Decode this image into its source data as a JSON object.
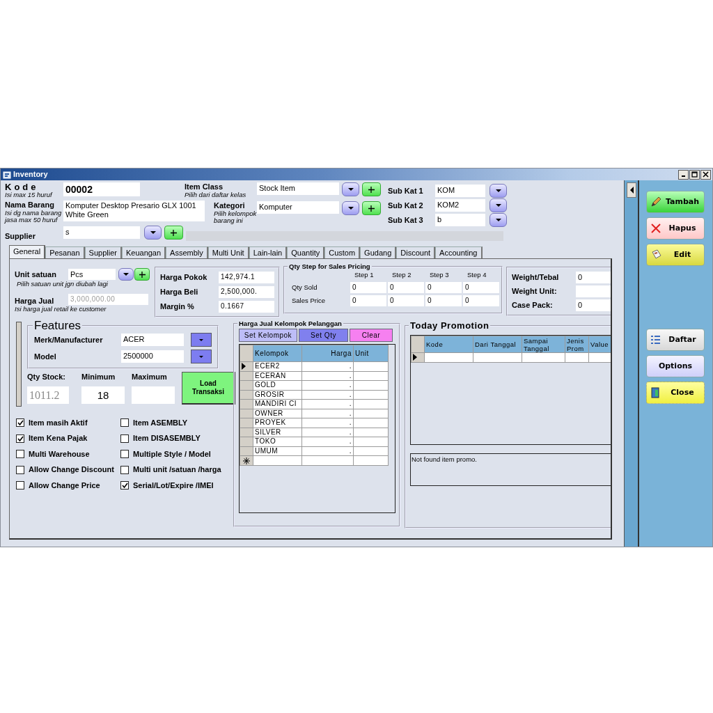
{
  "window": {
    "title": "Inventory"
  },
  "ident": [
    {
      "label": "Kode",
      "hints": [
        "Isi max 15 huruf"
      ],
      "value": "00002",
      "kind": "code"
    },
    {
      "label": "Nama Barang",
      "hints": [
        "Isi dg nama barang",
        "jasa max 50 huruf"
      ],
      "value": "Komputer Desktop Presario GLX 1001 White Green",
      "kind": "multiline"
    }
  ],
  "classes": [
    {
      "label": "Item Class",
      "hints": [
        "Pilih dari daftar kelas"
      ],
      "value": "Stock Item"
    },
    {
      "label": "Kategori",
      "hints": [
        "Pilih kelompok",
        "barang ini"
      ],
      "value": "Komputer"
    }
  ],
  "sub_categories": [
    {
      "label": "Sub Kat 1",
      "value": "KOM"
    },
    {
      "label": "Sub Kat 2",
      "value": "KOM2"
    },
    {
      "label": "Sub Kat 3",
      "value": "b"
    }
  ],
  "supplier": {
    "label": "Supplier",
    "value": "s"
  },
  "tabs": [
    {
      "label": "General",
      "selected": true
    },
    {
      "label": "Pesanan",
      "selected": false
    },
    {
      "label": "Supplier",
      "selected": false
    },
    {
      "label": "Keuangan",
      "selected": false
    },
    {
      "label": "Assembly",
      "selected": false
    },
    {
      "label": "Multi Unit",
      "selected": false
    },
    {
      "label": "Lain-lain",
      "selected": false
    },
    {
      "label": "Quantity",
      "selected": false
    },
    {
      "label": "Custom",
      "selected": false
    },
    {
      "label": "Gudang",
      "selected": false
    },
    {
      "label": "Discount",
      "selected": false
    },
    {
      "label": "Accounting",
      "selected": false
    }
  ],
  "unit": {
    "label": "Unit satuan",
    "value": "Pcs",
    "hint": "Pilih satuan unit jgn diubah lagi"
  },
  "sale_price": {
    "label": "Harga Jual",
    "value": "3,000,000.00",
    "disabled": true,
    "hint": "Isi harga jual retail ke customer"
  },
  "costs": [
    {
      "label": "Harga Pokok",
      "value": "142,974.1"
    },
    {
      "label": "Harga Beli",
      "value": "2,500,000."
    },
    {
      "label": "Margin %",
      "value": "0.1667"
    }
  ],
  "qty_step": {
    "title": "Qty Step for Sales Pricing",
    "steps": [
      "Step 1",
      "Step 2",
      "Step 3",
      "Step 4"
    ],
    "rows": [
      {
        "label": "Qty Sold",
        "values": [
          "0",
          "0",
          "0",
          "0"
        ]
      },
      {
        "label": "Sales Price",
        "values": [
          "0",
          "0",
          "0",
          "0"
        ]
      }
    ]
  },
  "weights": [
    {
      "label": "Weight/Tebal",
      "value": "0"
    },
    {
      "label": "Weight Unit:"
    },
    {
      "label": "Case Pack:",
      "value": "0"
    }
  ],
  "features": {
    "title": "Features",
    "rows": [
      {
        "label": "Merk/Manufacturer",
        "value": "ACER"
      },
      {
        "label": "Model",
        "value": "2500000"
      }
    ]
  },
  "stock": {
    "columns": [
      {
        "label": "Qty Stock:",
        "value": "1011.2",
        "disabled": true
      },
      {
        "label": "Minimum",
        "value": "18",
        "disabled": false
      },
      {
        "label": "Maximum"
      }
    ],
    "button": "Load Transaksi"
  },
  "checks": [
    {
      "label": "Item masih Aktif",
      "checked": true
    },
    {
      "label": "Item Kena Pajak",
      "checked": true
    },
    {
      "label": "Multi Warehouse",
      "checked": false
    },
    {
      "label": "Allow Change Discount",
      "checked": false
    },
    {
      "label": "Allow Change Price",
      "checked": false
    },
    {
      "label": "Item ASEMBLY",
      "checked": false
    },
    {
      "label": "Item DISASEMBLY",
      "checked": false
    },
    {
      "label": "Multiple Style / Model",
      "checked": false
    },
    {
      "label": "Multi unit /satuan /harga",
      "checked": false
    },
    {
      "label": "Serial/Lot/Expire /IMEI",
      "checked": true
    }
  ],
  "group_prices": {
    "title": "Harga Jual Kelompok Pelanggan",
    "buttons": [
      {
        "label": "Set Kelompok",
        "color": "#bdbdf7"
      },
      {
        "label": "Set Qty",
        "color": "#8080ee"
      },
      {
        "label": "Clear",
        "color": "#f680f0"
      }
    ],
    "columns": [
      "Kelompok",
      "Harga",
      "Unit"
    ],
    "rows": [
      {
        "kelompok": "ECER2",
        "harga": ".",
        "selected": true
      },
      {
        "kelompok": "ECERAN",
        "harga": ".",
        "selected": false
      },
      {
        "kelompok": "GOLD",
        "harga": ".",
        "selected": false
      },
      {
        "kelompok": "GROSIR",
        "harga": ".",
        "selected": false
      },
      {
        "kelompok": "MANDIRI CI",
        "harga": ".",
        "selected": false
      },
      {
        "kelompok": "OWNER",
        "harga": ".",
        "selected": false
      },
      {
        "kelompok": "PROYEK",
        "harga": ".",
        "selected": false
      },
      {
        "kelompok": "SILVER",
        "harga": ".",
        "selected": false
      },
      {
        "kelompok": "TOKO",
        "harga": ".",
        "selected": false
      },
      {
        "kelompok": "UMUM",
        "harga": ".",
        "selected": false
      }
    ]
  },
  "promotion": {
    "title": "Today Promotion",
    "columns": [
      "Kode",
      "Dari Tanggal",
      "Sampai Tanggal",
      "Jenis Prom",
      "Value"
    ],
    "rows": [
      {
        "selected": true
      }
    ],
    "message": "Not found item promo."
  },
  "actions_top": [
    {
      "label": "Tambah",
      "kind": "add"
    },
    {
      "label": "Hapus",
      "kind": "delete"
    },
    {
      "label": "Edit",
      "kind": "edit"
    }
  ],
  "actions_bottom": [
    {
      "label": "Daftar",
      "kind": "list"
    },
    {
      "label": "Options",
      "kind": "options"
    },
    {
      "label": "Close",
      "kind": "close"
    }
  ]
}
